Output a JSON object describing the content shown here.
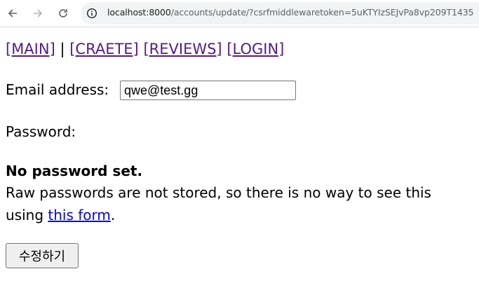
{
  "browser": {
    "url_host": "localhost:8000",
    "url_path": "/accounts/update/?csrfmiddlewaretoken=5uKTYIzSEJvPa8vp209T1435"
  },
  "nav": {
    "main": "[MAIN]",
    "separator": "|",
    "create": "[CRAETE]",
    "reviews": "[REVIEWS]",
    "login": "[LOGIN]"
  },
  "form": {
    "email_label": "Email address:",
    "email_value": "qwe@test.gg",
    "password_label": "Password:",
    "password_status": "No password set.",
    "password_help_line1": "Raw passwords are not stored, so there is no way to see this",
    "password_help_prefix": "using",
    "password_help_link": "this form",
    "password_help_suffix": ".",
    "submit_label": "수정하기"
  },
  "colors": {
    "visited_link": "#551a8b",
    "link": "#0000ee"
  }
}
